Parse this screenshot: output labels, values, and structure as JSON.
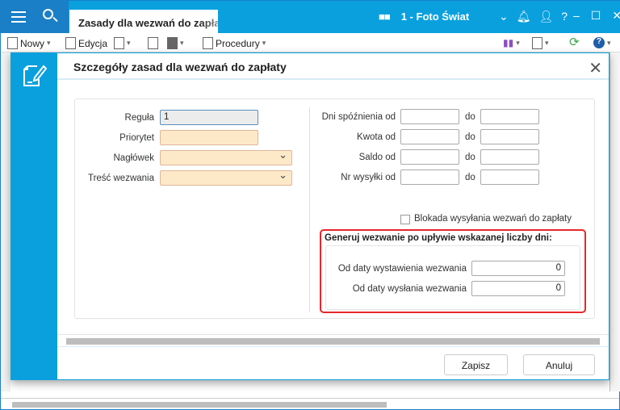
{
  "app": {
    "tab_title": "Zasady dla wezwań do zapłaty",
    "company": "1 - Foto Świat"
  },
  "toolbar": {
    "new": "Nowy",
    "edit": "Edycja",
    "procedures": "Procedury"
  },
  "dialog": {
    "title": "Szczegóły zasad dla wezwań do zapłaty",
    "left": {
      "rule_label": "Reguła",
      "rule_value": "1",
      "priority_label": "Priorytet",
      "priority_value": "",
      "header_label": "Nagłówek",
      "header_value": "",
      "content_label": "Treść wezwania",
      "content_value": ""
    },
    "right": {
      "rows": [
        {
          "label": "Dni spóźnienia od",
          "to": "do",
          "from_value": "",
          "to_value": ""
        },
        {
          "label": "Kwota od",
          "to": "do",
          "from_value": "",
          "to_value": ""
        },
        {
          "label": "Saldo od",
          "to": "do",
          "from_value": "",
          "to_value": ""
        },
        {
          "label": "Nr wysyłki od",
          "to": "do",
          "from_value": "",
          "to_value": ""
        }
      ],
      "block_label": "Blokada wysyłania wezwań do zapłaty",
      "block_checked": false
    },
    "generate": {
      "title": "Generuj wezwanie po upływie wskazanej liczby dni:",
      "issue_label": "Od daty wystawienia wezwania",
      "issue_value": "0",
      "send_label": "Od daty wysłania wezwania",
      "send_value": "0"
    },
    "save": "Zapisz",
    "cancel": "Anuluj"
  },
  "colors": {
    "accent": "#0aa0de",
    "highlight": "#e8262b",
    "required": "#fde9c8"
  }
}
